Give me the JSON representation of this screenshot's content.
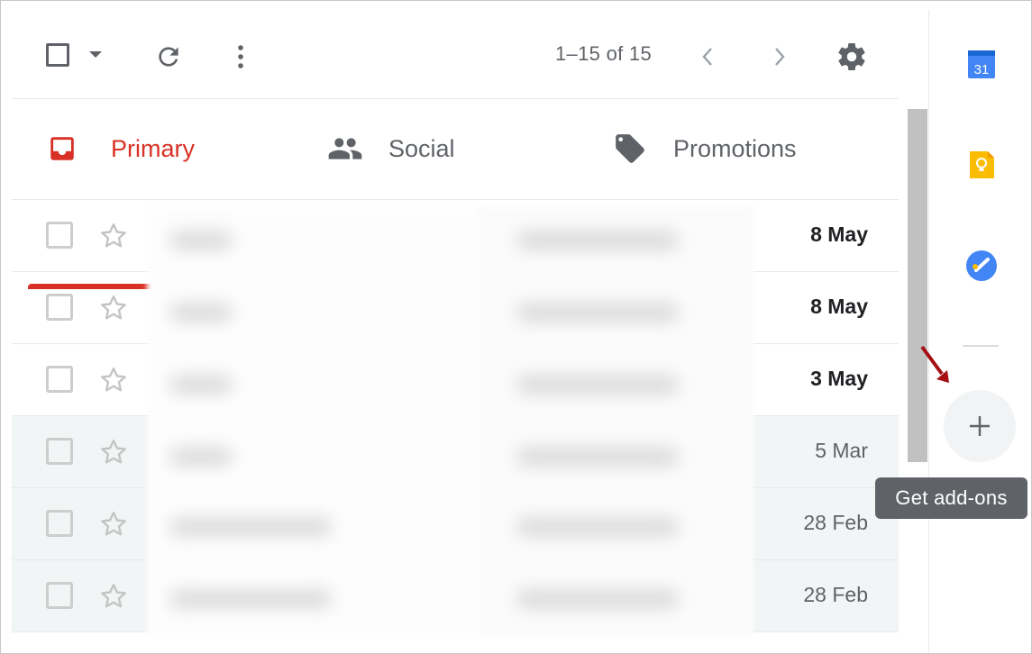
{
  "toolbar": {
    "page_count": "1–15 of 15",
    "icons": [
      "checkbox",
      "chevron-down-icon",
      "refresh-icon",
      "more-vert-icon",
      "chevron-left-icon",
      "chevron-right-icon",
      "gear-icon"
    ]
  },
  "tabs": [
    {
      "label": "Primary",
      "icon": "inbox-icon",
      "active": true
    },
    {
      "label": "Social",
      "icon": "people-icon",
      "active": false
    },
    {
      "label": "Promotions",
      "icon": "tag-icon",
      "active": false
    }
  ],
  "emails": [
    {
      "date": "8 May",
      "unread": true
    },
    {
      "date": "8 May",
      "unread": true
    },
    {
      "date": "3 May",
      "unread": true
    },
    {
      "date": "5 Mar",
      "unread": false
    },
    {
      "date": "28 Feb",
      "unread": false
    },
    {
      "date": "28 Feb",
      "unread": false
    }
  ],
  "side_panel": {
    "calendar_day": "31",
    "apps": [
      "calendar-icon",
      "keep-icon",
      "tasks-icon"
    ],
    "addon_tooltip": "Get add-ons"
  },
  "colors": {
    "accent_red": "#d93025",
    "calendar_blue": "#4285f4",
    "keep_yellow": "#fbbc04",
    "tooltip_bg": "#5f6368",
    "arrow_red": "#a40f12"
  }
}
